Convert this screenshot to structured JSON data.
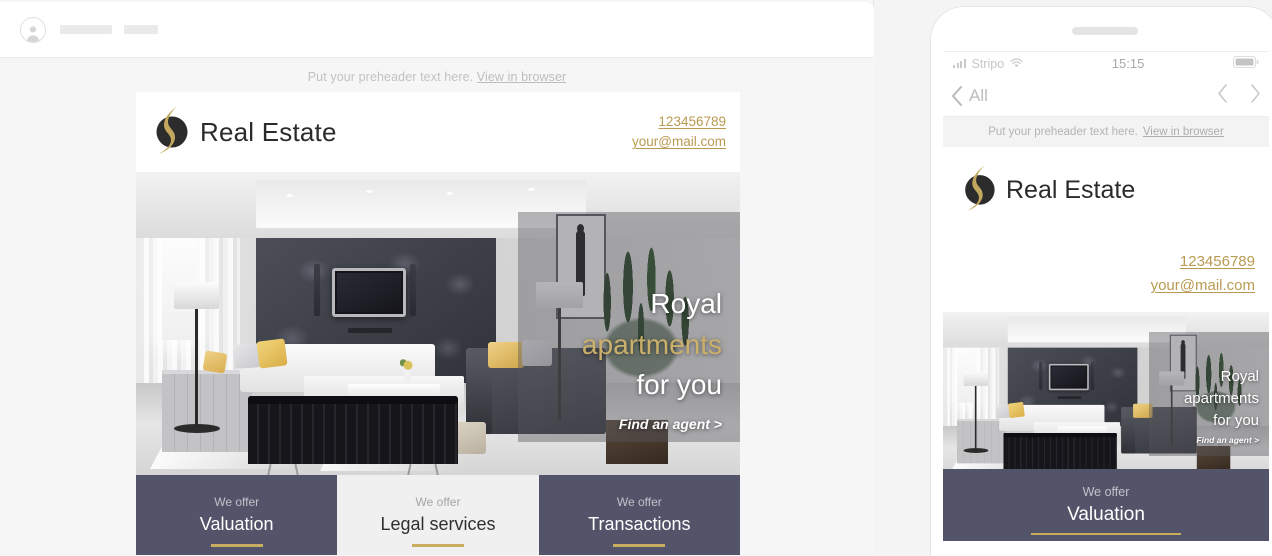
{
  "toolbar": {
    "avatar_icon": "user-avatar-icon",
    "placeholder_bars": 2
  },
  "email": {
    "preheader_text": "Put your preheader text here.",
    "view_in_browser": "View in browser",
    "brand_name": "Real Estate",
    "logo_icon": "flame-circle-logo",
    "contacts": {
      "phone": "123456789",
      "email": "your@mail.com"
    },
    "hero": {
      "line1": "Royal",
      "line2": "apartments",
      "line3": "for you",
      "cta": "Find an agent >"
    },
    "offers": [
      {
        "kicker": "We offer",
        "title": "Valuation",
        "theme": "dark"
      },
      {
        "kicker": "We offer",
        "title": "Legal services",
        "theme": "light"
      },
      {
        "kicker": "We offer",
        "title": "Transactions",
        "theme": "dark"
      }
    ]
  },
  "mobile": {
    "status": {
      "carrier": "Stripo",
      "time": "15:15",
      "signal_icon": "signal-bars-icon",
      "wifi_icon": "wifi-icon",
      "battery_icon": "battery-icon"
    },
    "nav": {
      "back_label": "All",
      "back_icon": "chevron-left-icon",
      "prev_icon": "chevron-left-icon",
      "next_icon": "chevron-right-icon"
    },
    "offer": {
      "kicker": "We offer",
      "title": "Valuation"
    }
  },
  "colors": {
    "gold": "#c9ae62",
    "link_gold": "#b99a52",
    "panel_dark": "#535469",
    "panel_light": "#f0f0f0",
    "page_bg": "#f4f4f4"
  }
}
